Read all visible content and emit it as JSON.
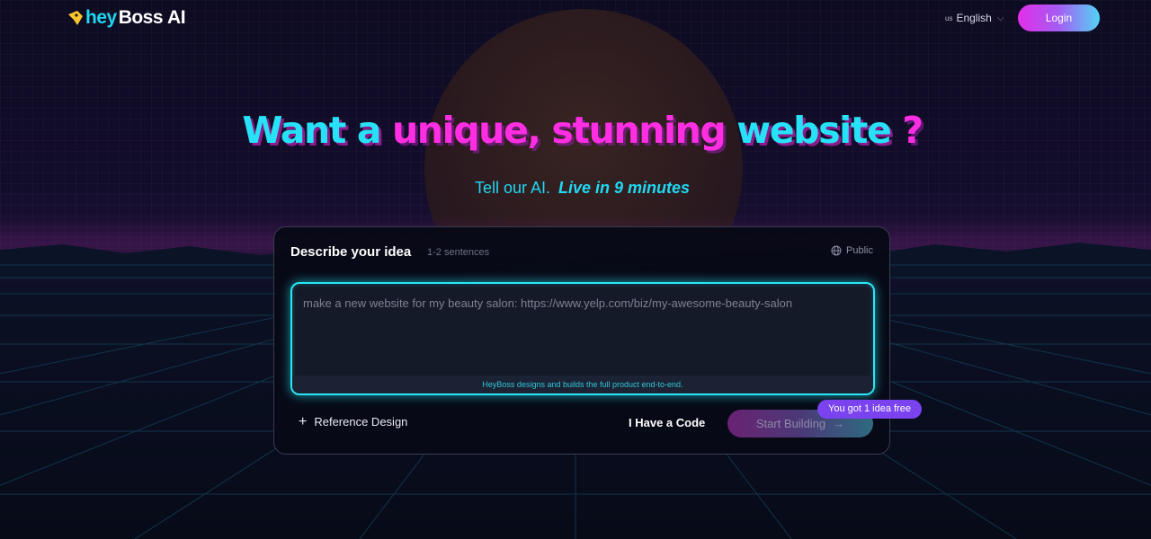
{
  "header": {
    "brand": {
      "part1": "hey",
      "part2": "Boss",
      "part3": "AI"
    },
    "language": {
      "flag": "us",
      "label": "English"
    },
    "login_label": "Login"
  },
  "hero": {
    "title": {
      "w1": "Want a",
      "w2": "unique, stunning",
      "w3": "website",
      "w4": "?"
    },
    "subtitle": "Tell our AI.",
    "subtitle_emphasis": "Live in 9 minutes"
  },
  "card": {
    "title": "Describe your idea",
    "hint": "1-2 sentences",
    "visibility": "Public",
    "input_placeholder": "make a new website for my beauty salon: https://www.yelp.com/biz/my-awesome-beauty-salon",
    "input_footer": "HeyBoss designs and builds the full product end-to-end.",
    "reference_label": "Reference Design",
    "code_label": "I Have a Code",
    "start_label": "Start Building",
    "free_badge": "You got 1 idea free"
  },
  "colors": {
    "accent_cyan": "#27e2f6",
    "accent_magenta": "#ff2ee3",
    "badge_purple": "#7b42f0"
  }
}
